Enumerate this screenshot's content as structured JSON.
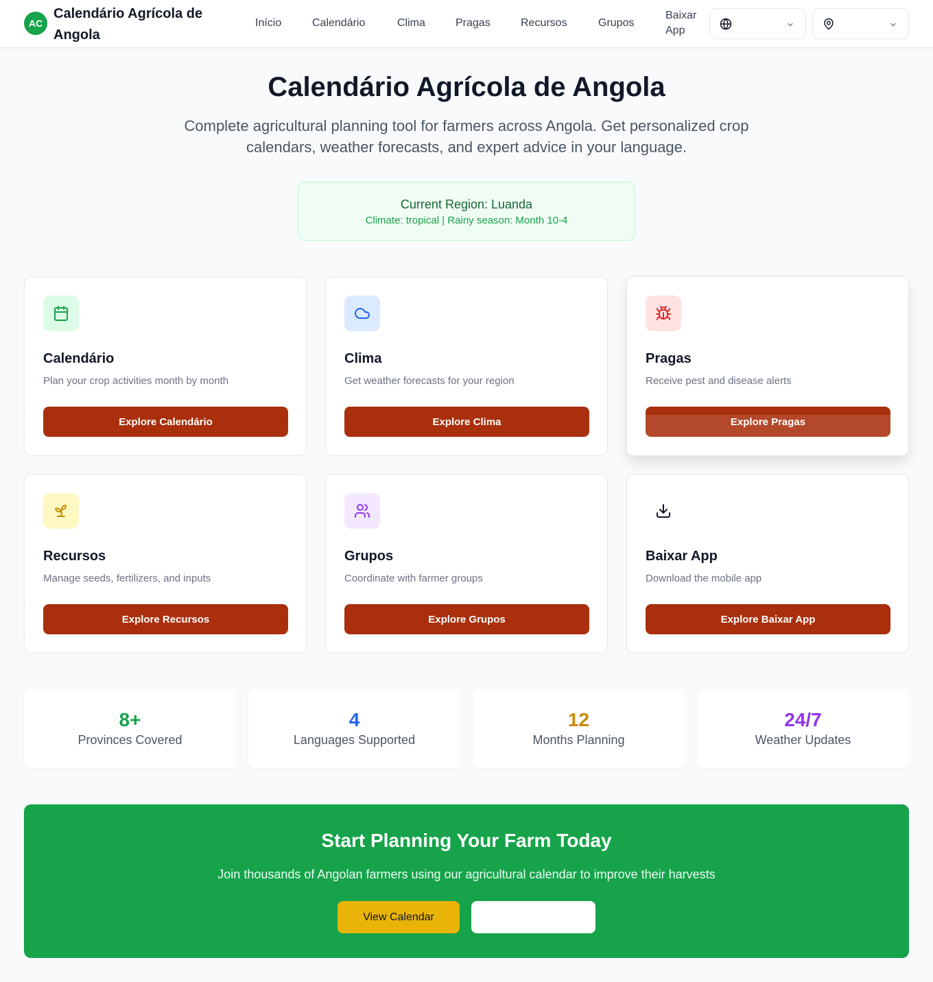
{
  "header": {
    "logo_initials": "AC",
    "brand_title": "Calendário Agrícola de Angola",
    "nav": [
      "Início",
      "Calendário",
      "Clima",
      "Pragas",
      "Recursos",
      "Grupos",
      "Baixar App"
    ],
    "language_selector_icon": "globe-icon",
    "location_selector_icon": "map-pin-icon"
  },
  "hero": {
    "title": "Calendário Agrícola de Angola",
    "subtitle": "Complete agricultural planning tool for farmers across Angola. Get personalized crop calendars, weather forecasts, and expert advice in your language."
  },
  "region": {
    "title": "Current Region: Luanda",
    "details": "Climate: tropical | Rainy season: Month 10-4"
  },
  "cards": [
    {
      "title": "Calendário",
      "desc": "Plan your crop activities month by month",
      "button": "Explore Calendário",
      "icon": "calendar-icon",
      "icon_color": "#16a34a",
      "icon_bg": "#dcfce7"
    },
    {
      "title": "Clima",
      "desc": "Get weather forecasts for your region",
      "button": "Explore Clima",
      "icon": "cloud-icon",
      "icon_color": "#2563eb",
      "icon_bg": "#dbeafe"
    },
    {
      "title": "Pragas",
      "desc": "Receive pest and disease alerts",
      "button": "Explore Pragas",
      "icon": "bug-icon",
      "icon_color": "#dc2626",
      "icon_bg": "#fee2e2"
    },
    {
      "title": "Recursos",
      "desc": "Manage seeds, fertilizers, and inputs",
      "button": "Explore Recursos",
      "icon": "sprout-icon",
      "icon_color": "#ca8a04",
      "icon_bg": "#fef9c3"
    },
    {
      "title": "Grupos",
      "desc": "Coordinate with farmer groups",
      "button": "Explore Grupos",
      "icon": "users-icon",
      "icon_color": "#9333ea",
      "icon_bg": "#f3e8ff"
    },
    {
      "title": "Baixar App",
      "desc": "Download the mobile app",
      "button": "Explore Baixar App",
      "icon": "download-icon",
      "icon_color": "#111827",
      "icon_bg": "#ffffff"
    }
  ],
  "stats": [
    {
      "value": "8+",
      "label": "Provinces Covered",
      "color": "#16a34a"
    },
    {
      "value": "4",
      "label": "Languages Supported",
      "color": "#2563eb"
    },
    {
      "value": "12",
      "label": "Months Planning",
      "color": "#ca8a04"
    },
    {
      "value": "24/7",
      "label": "Weather Updates",
      "color": "#9333ea"
    }
  ],
  "cta": {
    "title": "Start Planning Your Farm Today",
    "subtitle": "Join thousands of Angolan farmers using our agricultural calendar to improve their harvests",
    "primary_button": "View Calendar",
    "secondary_button": ""
  },
  "colors": {
    "brand_green": "#16a34a",
    "button_rust": "#a92f0d",
    "cta_yellow": "#eab308"
  }
}
